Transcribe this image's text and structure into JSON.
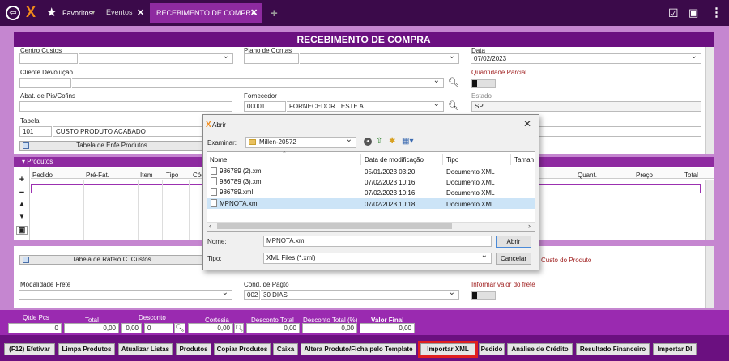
{
  "topbar": {
    "favorites_label": "Favoritos",
    "tab_events": "Eventos",
    "tab_active": "RECEBIMENTO DE COMPRA"
  },
  "header": {
    "title": "RECEBIMENTO DE COMPRA"
  },
  "form": {
    "centro_custos_label": "Centro Custos",
    "plano_contas_label": "Plano de Contas",
    "data_label": "Data",
    "data_value": "07/02/2023",
    "cliente_devolucao_label": "Cliente Devolução",
    "quantidade_parcial_label": "Quantidade Parcial",
    "abat_pis_label": "Abat. de Pis/Cofins",
    "fornecedor_label": "Fornecedor",
    "fornecedor_code": "00001",
    "fornecedor_name": "FORNECEDOR TESTE A",
    "estado_label": "Estado",
    "estado_value": "SP",
    "tabela_label": "Tabela",
    "tabela_code": "101",
    "tabela_name": "CUSTO PRODUTO ACABADO",
    "enfe_button": "Tabela de Enfe Produtos"
  },
  "products": {
    "section_label": "Produtos",
    "columns": [
      "Pedido",
      "Pré-Fat.",
      "Item",
      "Tipo",
      "Cód",
      "Quant.",
      "Preço",
      "Total"
    ]
  },
  "lower": {
    "rateio_button": "Tabela de Rateio C. Custos",
    "custo_label": "stos no Custo do Produto",
    "modalidade_label": "Modalidade Frete",
    "cond_pagto_label": "Cond. de Pagto",
    "cond_pagto_code": "002",
    "cond_pagto_value": "30 DIAS",
    "informar_frete_label": "Informar valor do frete"
  },
  "totals": {
    "qtde_pcs_label": "Qtde Pcs",
    "qtde_pcs_value": "0",
    "total_label": "Total",
    "total_value": "0,00",
    "desconto_label": "Desconto",
    "desconto_pct": "0,00",
    "desconto_value": "0",
    "cortesia_label": "Cortesia",
    "cortesia_value": "0,00",
    "desconto_total_label": "Desconto Total",
    "desconto_total_value": "0,00",
    "desconto_total_pct_label": "Desconto Total (%)",
    "desconto_total_pct_value": "0,00",
    "valor_final_label": "Valor Final",
    "valor_final_value": "0,00"
  },
  "toolbar": {
    "efetivar": "(F12) Efetivar",
    "limpa": "Limpa Produtos",
    "atualizar": "Atualizar Listas",
    "produtos": "Produtos",
    "copiar": "Copiar Produtos",
    "caixa": "Caixa",
    "altera": "Altera Produto/Ficha pelo Template",
    "importar_xml": "Importar XML",
    "pedido": "Pedido",
    "analise": "Análise de Crédito",
    "resultado": "Resultado Financeiro",
    "importar_di": "Importar DI"
  },
  "dialog": {
    "title": "Abrir",
    "examinar_label": "Examinar:",
    "folder": "Millen-20572",
    "col_nome": "Nome",
    "col_data": "Data de modificação",
    "col_tipo": "Tipo",
    "col_tamanho": "Taman",
    "files": [
      {
        "name": "986789 (2).xml",
        "date": "05/01/2023 03:20",
        "type": "Documento XML"
      },
      {
        "name": "986789 (3).xml",
        "date": "07/02/2023 10:16",
        "type": "Documento XML"
      },
      {
        "name": "986789.xml",
        "date": "07/02/2023 10:16",
        "type": "Documento XML"
      },
      {
        "name": "MPNOTA.xml",
        "date": "07/02/2023 10:18",
        "type": "Documento XML"
      }
    ],
    "nome_label": "Nome:",
    "nome_value": "MPNOTA.xml",
    "tipo_label": "Tipo:",
    "tipo_value": "XML Files (*.xml)",
    "abrir_button": "Abrir",
    "cancelar_button": "Cancelar"
  }
}
